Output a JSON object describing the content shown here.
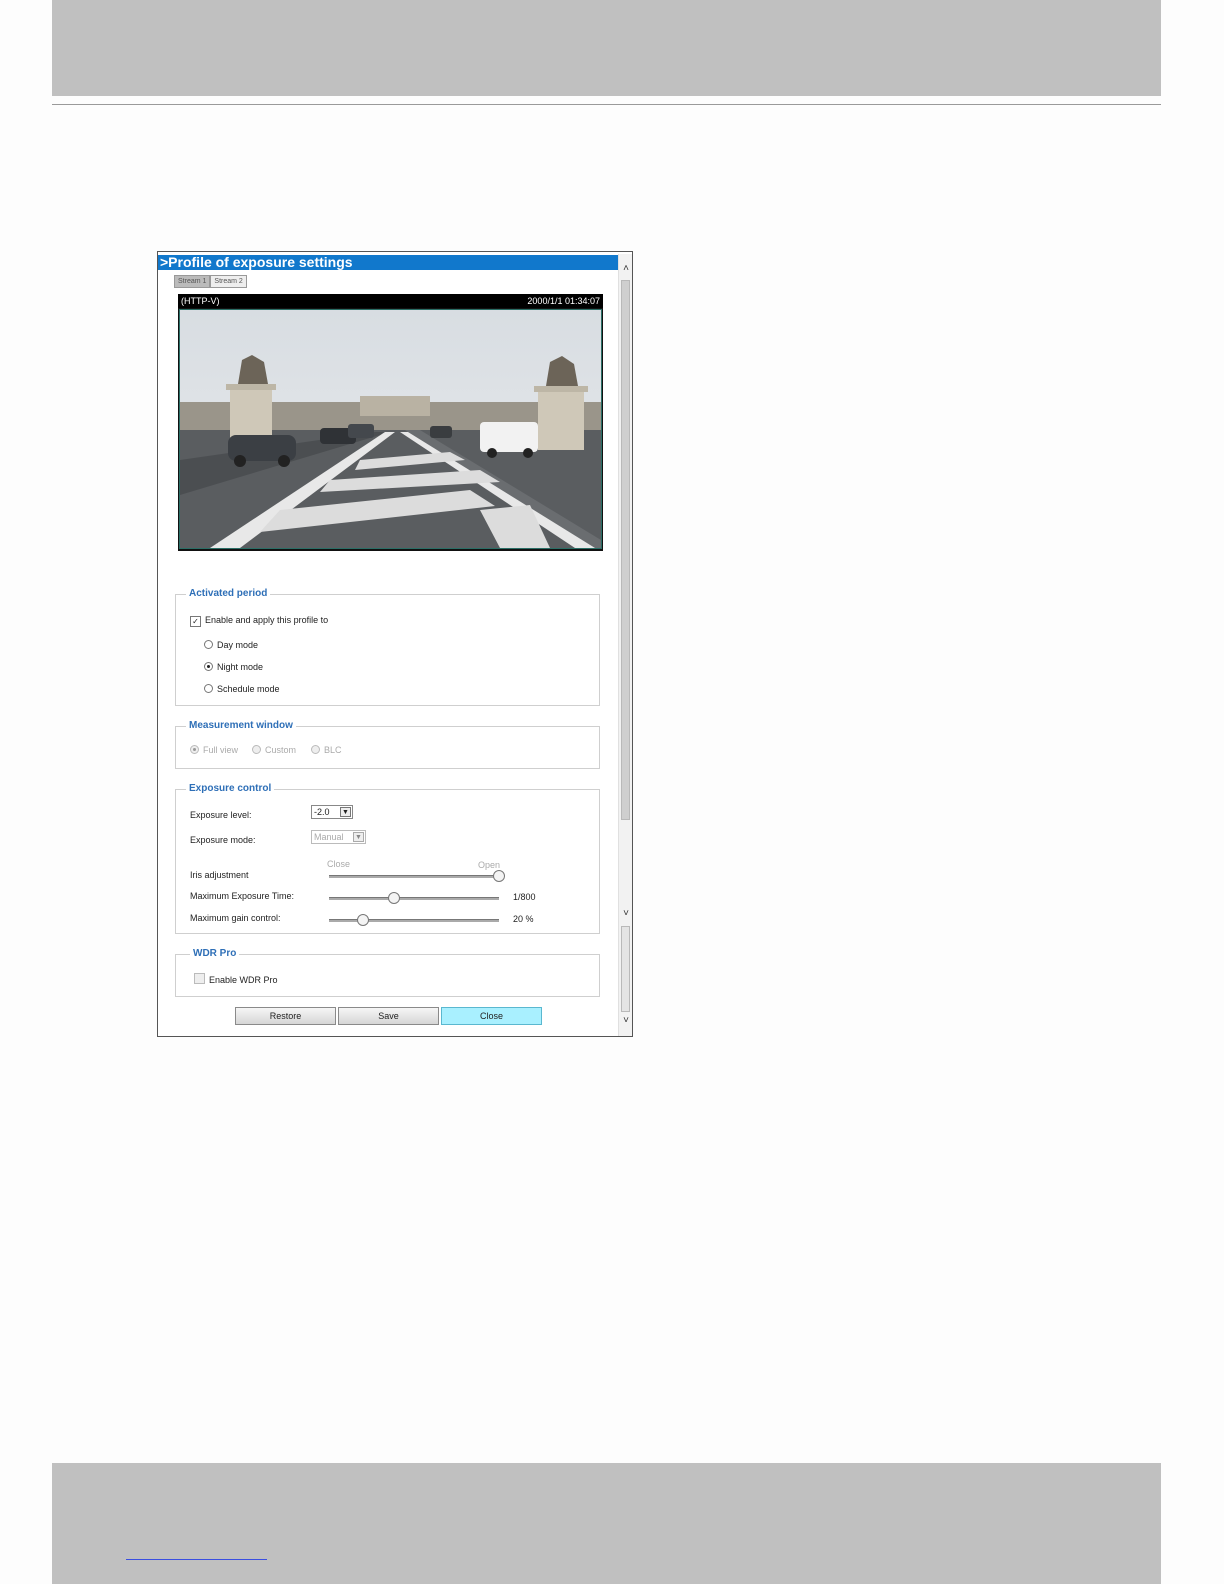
{
  "window": {
    "title": ">Profile of exposure settings"
  },
  "stream_tabs": [
    "Stream 1",
    "Stream 2"
  ],
  "video": {
    "protocol": "(HTTP-V)",
    "timestamp": "2000/1/1 01:34:07"
  },
  "activated_period": {
    "legend": "Activated period",
    "enable_label": "Enable and apply this profile to",
    "enable_checked": true,
    "options": [
      "Day mode",
      "Night mode",
      "Schedule mode"
    ],
    "selected": "Night mode"
  },
  "measurement_window": {
    "legend": "Measurement window",
    "options": [
      "Full view",
      "Custom",
      "BLC"
    ],
    "selected": "Full view"
  },
  "exposure_control": {
    "legend": "Exposure control",
    "exposure_level_label": "Exposure level:",
    "exposure_level_value": "-2.0",
    "exposure_mode_label": "Exposure mode:",
    "exposure_mode_value": "Manual",
    "iris_label": "Iris adjustment",
    "iris_close_label": "Close",
    "iris_open_label": "Open",
    "iris_level": 1.0,
    "max_exposure_label": "Maximum Exposure Time:",
    "max_exposure_value": "1/800",
    "max_exposure_level": 0.38,
    "max_gain_label": "Maximum gain control:",
    "max_gain_value": "20 %",
    "max_gain_level": 0.2
  },
  "wdr": {
    "legend": "WDR Pro",
    "enable_label": "Enable WDR Pro",
    "enable_checked": false
  },
  "buttons": {
    "restore": "Restore",
    "save": "Save",
    "close": "Close"
  },
  "colors": {
    "title_bar": "#1178cc",
    "legend_text": "#2e6fb7",
    "close_button": "#a9f0ff"
  }
}
